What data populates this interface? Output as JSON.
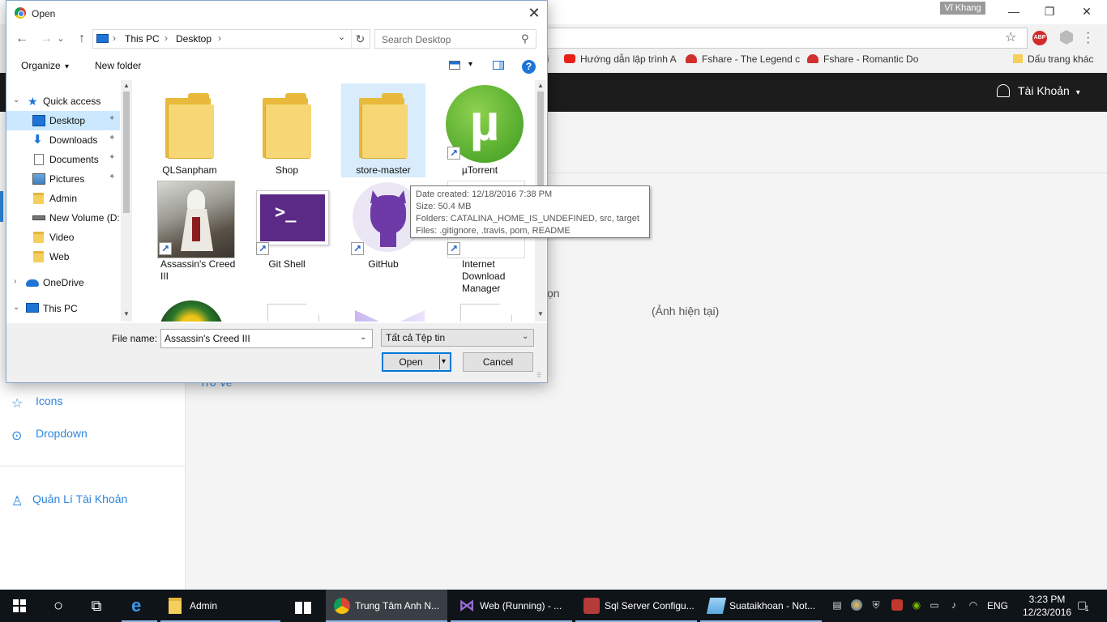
{
  "browser": {
    "profile_name": "Vĩ Khang",
    "window_controls": {
      "minimize": "—",
      "restore": "❐",
      "close": "✕"
    },
    "bookmarks": [
      {
        "label": "Hướng dẫn lập trình A",
        "icon": "youtube-icon",
        "color": "#e62117"
      },
      {
        "label": "Fshare - The Legend c",
        "icon": "fshare-icon",
        "color": "#d0312d"
      },
      {
        "label": "Fshare - Romantic Do",
        "icon": "fshare-icon",
        "color": "#d0312d"
      },
      {
        "label": "Dấu trang khác",
        "icon": "folder-icon",
        "color": "#f4cf5b"
      }
    ],
    "partial_bookmark": "i",
    "abp_label": "ABP"
  },
  "site": {
    "account_label": "Tài Khoản",
    "account_caret": "▾",
    "sidebar_links": [
      {
        "label": "Icons",
        "icon": "star-icon",
        "glyph": "☆"
      },
      {
        "label": "Dropdown",
        "icon": "chevron-circle-icon",
        "glyph": "⊙"
      }
    ],
    "sidebar_account_link": {
      "label": "Quản Lí Tài Khoản",
      "icon": "user-icon",
      "glyph": "♙"
    },
    "main_partial_text": "ọn",
    "main_current_image": "(Ảnh hiện tại)",
    "main_back_link": "Trở về"
  },
  "dialog": {
    "title": "Open",
    "close": "✕",
    "nav": {
      "back": "←",
      "forward": "→",
      "recent": "⌄",
      "up": "↑"
    },
    "breadcrumb": [
      "This PC",
      "Desktop"
    ],
    "breadcrumb_sep": "›",
    "refresh": "↻",
    "search_placeholder": "Search Desktop",
    "search_icon": "⚲",
    "organize": "Organize",
    "organize_caret": "▾",
    "new_folder": "New folder",
    "help": "?",
    "nav_pane": [
      {
        "label": "Quick access",
        "icon": "star-icon",
        "chevron": "⌄",
        "pinned": false
      },
      {
        "label": "Desktop",
        "icon": "desktop-icon",
        "pinned": true,
        "selected": true
      },
      {
        "label": "Downloads",
        "icon": "download-icon",
        "pinned": true
      },
      {
        "label": "Documents",
        "icon": "document-icon",
        "pinned": true
      },
      {
        "label": "Pictures",
        "icon": "picture-icon",
        "pinned": true
      },
      {
        "label": "Admin",
        "icon": "folder-icon",
        "pinned": false
      },
      {
        "label": "New Volume (D:",
        "icon": "drive-icon",
        "pinned": false
      },
      {
        "label": "Video",
        "icon": "folder-icon",
        "pinned": false
      },
      {
        "label": "Web",
        "icon": "folder-icon",
        "pinned": false
      },
      {
        "label": "OneDrive",
        "icon": "onedrive-icon",
        "chevron": "›",
        "pinned": false
      },
      {
        "label": "This PC",
        "icon": "pc-icon",
        "chevron": "⌄",
        "pinned": false
      }
    ],
    "pin_glyph": "📌",
    "files": [
      {
        "label": "QLSanpham",
        "type": "folder"
      },
      {
        "label": "Shop",
        "type": "folder"
      },
      {
        "label": "store-master",
        "type": "folder",
        "selected": true
      },
      {
        "label": "µTorrent",
        "type": "shortcut"
      },
      {
        "label": "Assassin's Creed III",
        "type": "shortcut"
      },
      {
        "label": "Git Shell",
        "type": "shortcut"
      },
      {
        "label": "GitHub",
        "type": "shortcut"
      },
      {
        "label": "Internet Download Manager",
        "type": "shortcut"
      }
    ],
    "shortcut_arrow": "↗",
    "tooltip": {
      "date_created": "Date created: 12/18/2016 7:38 PM",
      "size": "Size: 50.4 MB",
      "folders": "Folders: CATALINA_HOME_IS_UNDEFINED, src, target",
      "files": "Files: .gitignore, .travis, pom, README"
    },
    "file_name_label": "File name:",
    "file_name_value": "Assassin's Creed III",
    "file_type_value": "Tất cả Tệp tin",
    "dropdown_caret": "⌄",
    "open_button": "Open",
    "open_split_caret": "▾",
    "cancel_button": "Cancel",
    "grip": "⠿"
  },
  "taskbar": {
    "search_icon": "○",
    "task_view_icon": "⧉",
    "items": [
      {
        "label": "",
        "icon": "edge-icon"
      },
      {
        "label": "Admin",
        "icon": "file-explorer-icon"
      },
      {
        "label": "",
        "icon": "store-icon"
      },
      {
        "label": "Trung Tâm Anh N...",
        "icon": "chrome-icon",
        "active": true
      },
      {
        "label": "Web (Running) - ...",
        "icon": "visual-studio-icon"
      },
      {
        "label": "Sql Server Configu...",
        "icon": "sql-config-icon"
      },
      {
        "label": "Suataikhoan - Not...",
        "icon": "notepad-icon"
      }
    ],
    "language": "ENG",
    "time": "3:23 PM",
    "date": "12/23/2016",
    "notification_count": "1"
  }
}
